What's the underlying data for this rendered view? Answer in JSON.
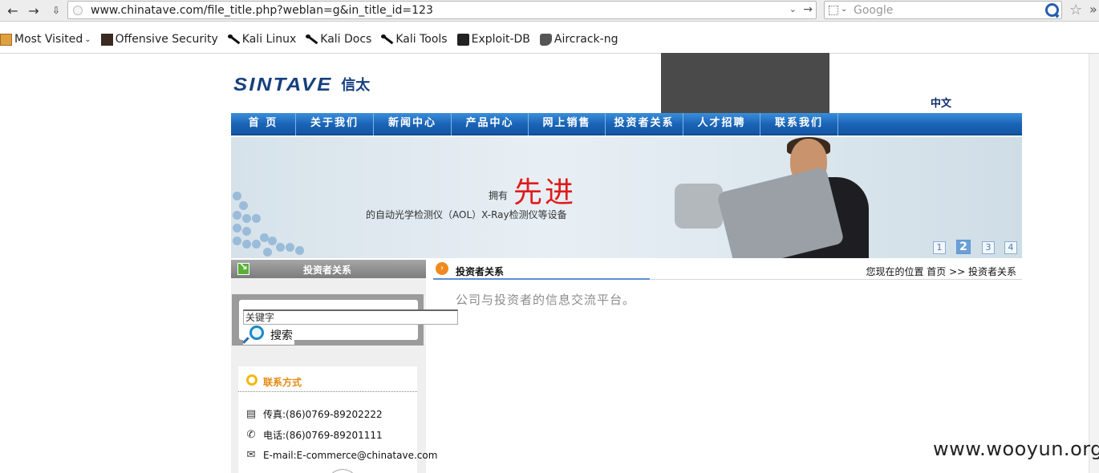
{
  "browser": {
    "url": "www.chinatave.com/file_title.php?weblan=g&in_title_id=123",
    "search_placeholder": "Google",
    "bookmarks": [
      {
        "label": "Most Visited",
        "icon": "folder-icon"
      },
      {
        "label": "Offensive Security",
        "icon": "offsec-icon"
      },
      {
        "label": "Kali Linux",
        "icon": "kali-icon"
      },
      {
        "label": "Kali Docs",
        "icon": "kali-icon"
      },
      {
        "label": "Kali Tools",
        "icon": "kali-icon"
      },
      {
        "label": "Exploit-DB",
        "icon": "exploitdb-icon"
      },
      {
        "label": "Aircrack-ng",
        "icon": "aircrack-icon"
      }
    ]
  },
  "site": {
    "logo_en": "SINTAVE",
    "logo_cn": "信太",
    "lang": "中文",
    "menu": [
      "首 页",
      "关于我们",
      "新闻中心",
      "产品中心",
      "网上销售",
      "投资者关系",
      "人才招聘",
      "联系我们"
    ],
    "banner": {
      "own": "拥有",
      "big": "先进",
      "sub": "的自动光学检测仪（AOL）X-Ray检测仪等设备",
      "pages": [
        "1",
        "2",
        "3",
        "4"
      ],
      "active_page": "2"
    },
    "sidebar": {
      "title": "投资者关系",
      "search_placeholder": "关键字",
      "search_button": "搜索",
      "contact_title": "联系方式",
      "fax": "传真:(86)0769-89202222",
      "phone": "电话:(86)0769-89201111",
      "email": "E-mail:E-commerce@chinatave.com"
    },
    "content": {
      "title": "投资者关系",
      "breadcrumb": "您现在的位置 首页 >> 投资者关系",
      "text": "公司与投资者的信息交流平台。"
    }
  },
  "watermark": "www.wooyun.org",
  "colors": {
    "menu_blue": "#1a62b4",
    "banner_red": "#e01b1b",
    "contact_orange": "#e58a12"
  }
}
